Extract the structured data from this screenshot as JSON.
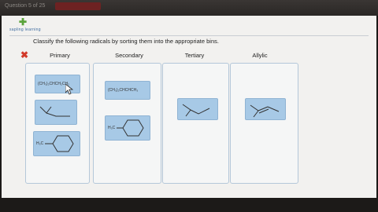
{
  "window": {
    "question_label": "Question 5 of 25"
  },
  "header": {
    "logo_text": "sapling learning"
  },
  "instructions": "Classify the following radicals by sorting them into the appropriate bins.",
  "status": {
    "incorrect_icon": "x-mark-icon",
    "color": "#d23a2a"
  },
  "bins": [
    {
      "name": "Primary"
    },
    {
      "name": "Secondary"
    },
    {
      "name": "Tertiary"
    },
    {
      "name": "Allylic"
    }
  ],
  "cards": {
    "primary_formula": "(CH₃)₂CHCH₂CH₂",
    "secondary_formula": "(CH₃)₂CHCHCH₃",
    "methyl_label_1": "H₃C",
    "methyl_label_2": "H₃C"
  },
  "colors": {
    "card_fill": "#a7c9e6",
    "bin_border": "#b4c7d9",
    "accent_green": "#5aa33a"
  }
}
